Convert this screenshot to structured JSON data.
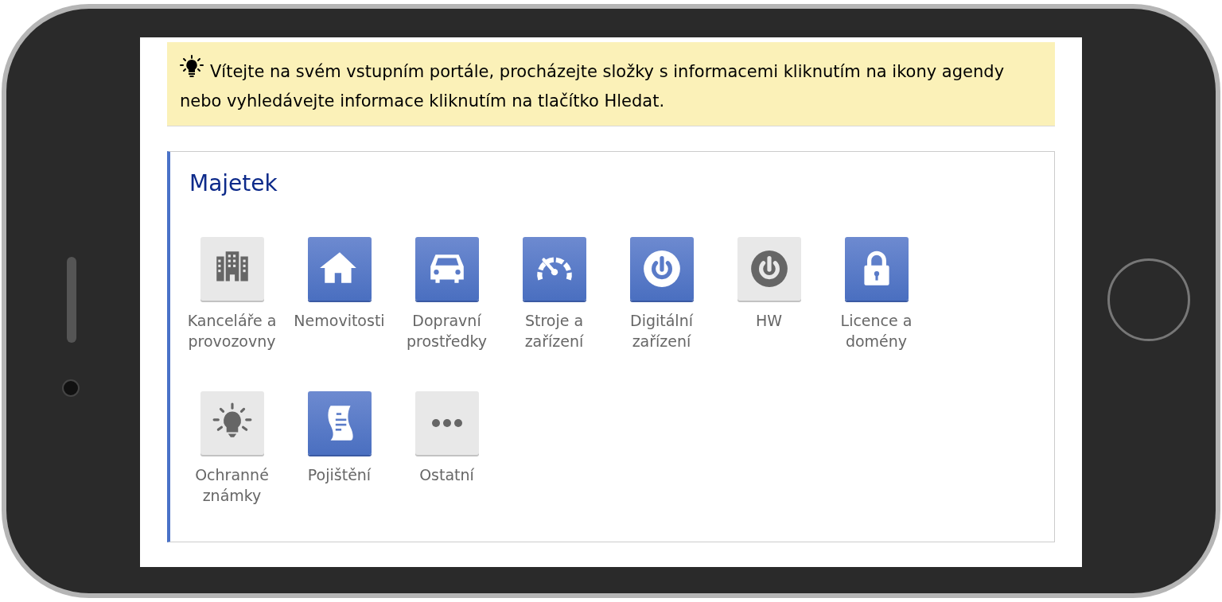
{
  "banner": {
    "text": "Vítejte na svém vstupním portále, procházejte složky s informacemi kliknutím na ikony agendy nebo vyhledávejte informace kliknutím na tlačítko Hledat."
  },
  "section": {
    "title": "Majetek",
    "tiles": [
      {
        "label": "Kanceláře a provozovny",
        "highlighted": false,
        "kind": "building"
      },
      {
        "label": "Nemovitosti",
        "highlighted": true,
        "kind": "house"
      },
      {
        "label": "Dopravní prostředky",
        "highlighted": true,
        "kind": "car"
      },
      {
        "label": "Stroje a zařízení",
        "highlighted": true,
        "kind": "gauge"
      },
      {
        "label": "Digitální zařízení",
        "highlighted": true,
        "kind": "power"
      },
      {
        "label": "HW",
        "highlighted": false,
        "kind": "power"
      },
      {
        "label": "Licence a domény",
        "highlighted": true,
        "kind": "lock"
      },
      {
        "label": "Ochranné známky",
        "highlighted": false,
        "kind": "bulb"
      },
      {
        "label": "Pojištění",
        "highlighted": true,
        "kind": "document"
      },
      {
        "label": "Ostatní",
        "highlighted": false,
        "kind": "dots"
      }
    ]
  }
}
